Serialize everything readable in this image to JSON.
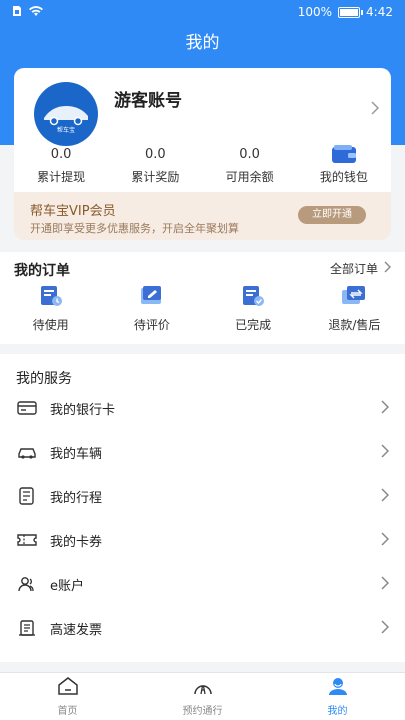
{
  "status_bar": {
    "battery": "100%",
    "time": "4:42"
  },
  "header": {
    "title": "我的"
  },
  "profile": {
    "logo_text": "帮车宝",
    "name": "游客账号"
  },
  "stats": [
    {
      "value": "0.0",
      "label": "累计提现"
    },
    {
      "value": "0.0",
      "label": "累计奖励"
    },
    {
      "value": "0.0",
      "label": "可用余额"
    },
    {
      "value": "",
      "label": "我的钱包"
    }
  ],
  "vip": {
    "title": "帮车宝VIP会员",
    "subtitle": "开通即享受更多优惠服务，开启全年聚划算",
    "button": "立即开通"
  },
  "orders": {
    "title": "我的订单",
    "all_label": "全部订单",
    "items": [
      {
        "label": "待使用",
        "icon": "pending-use-icon"
      },
      {
        "label": "待评价",
        "icon": "pending-review-icon"
      },
      {
        "label": "已完成",
        "icon": "completed-icon"
      },
      {
        "label": "退款/售后",
        "icon": "refund-icon"
      }
    ]
  },
  "services": {
    "title": "我的服务",
    "items": [
      {
        "label": "我的银行卡",
        "icon": "bank-card-icon"
      },
      {
        "label": "我的车辆",
        "icon": "car-icon"
      },
      {
        "label": "我的行程",
        "icon": "trip-icon"
      },
      {
        "label": "我的卡券",
        "icon": "coupon-icon"
      },
      {
        "label": "e账户",
        "icon": "e-account-icon"
      },
      {
        "label": "高速发票",
        "icon": "invoice-icon"
      }
    ]
  },
  "tabbar": {
    "items": [
      {
        "label": "首页",
        "icon": "home-icon",
        "active": false
      },
      {
        "label": "预约通行",
        "icon": "road-icon",
        "active": false
      },
      {
        "label": "我的",
        "icon": "user-icon",
        "active": true
      }
    ]
  },
  "colors": {
    "primary": "#2f8af5",
    "vip_bg": "#f6ece3",
    "vip_text": "#8a5a2b"
  }
}
